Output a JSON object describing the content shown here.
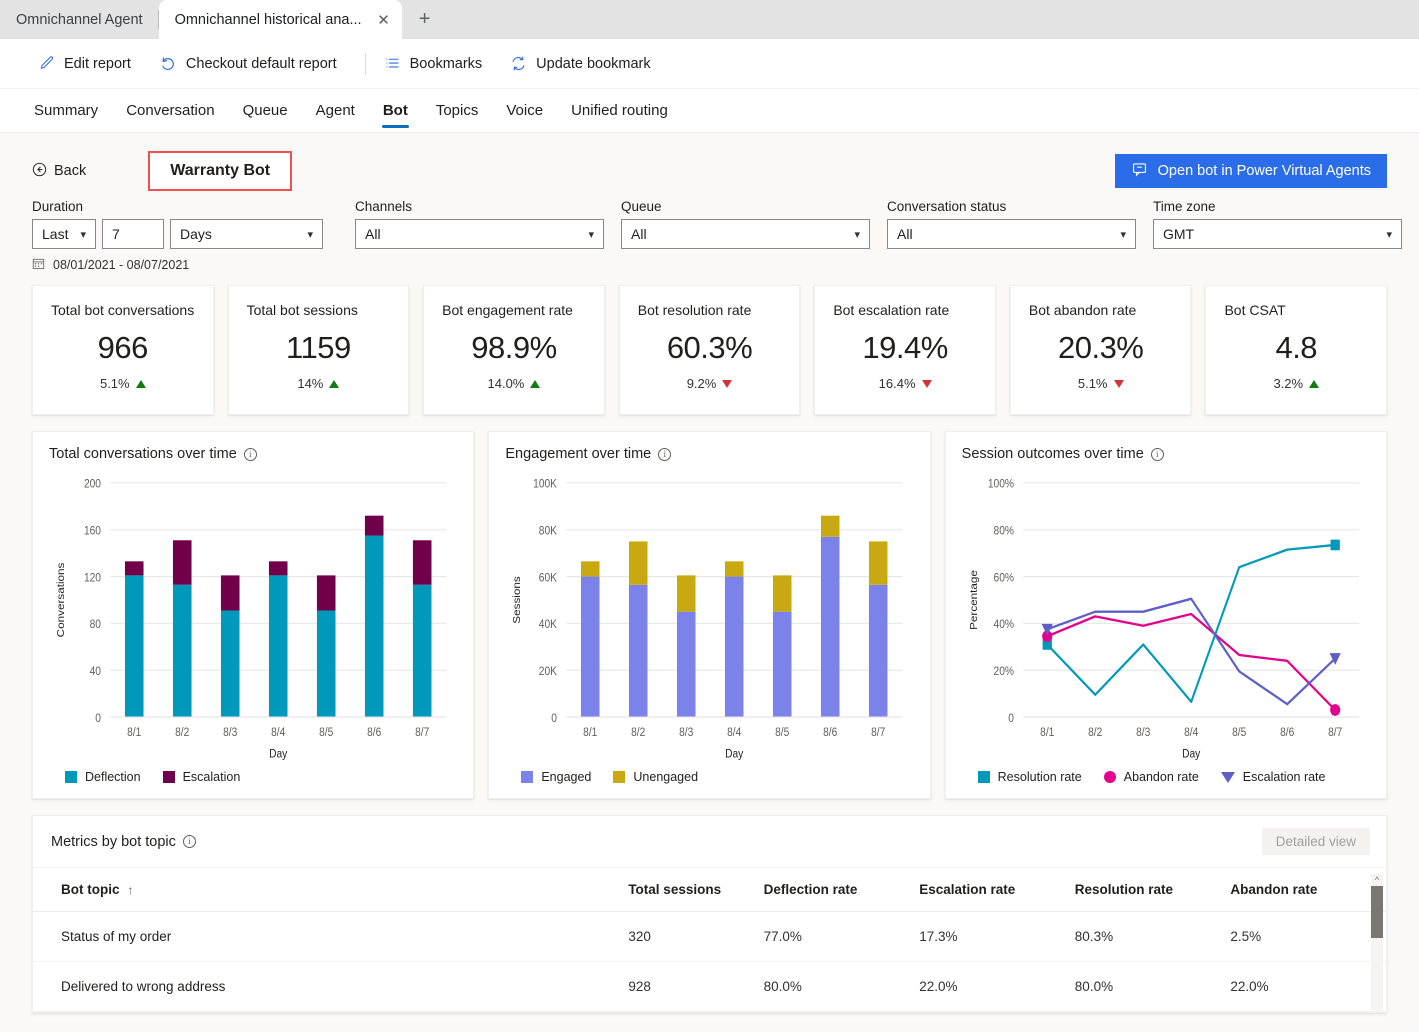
{
  "browser": {
    "tabs": [
      {
        "title": "Omnichannel Agent",
        "active": false
      },
      {
        "title": "Omnichannel historical ana...",
        "active": true
      }
    ],
    "close_icon": "close-icon",
    "new_tab_icon": "plus-icon"
  },
  "commandbar": {
    "items": [
      {
        "label": "Edit report",
        "icon": "pencil-icon"
      },
      {
        "label": "Checkout default report",
        "icon": "undo-icon"
      },
      {
        "label": "Bookmarks",
        "icon": "list-icon"
      },
      {
        "label": "Update bookmark",
        "icon": "refresh-icon"
      }
    ]
  },
  "nav": {
    "tabs": [
      {
        "label": "Summary",
        "selected": false
      },
      {
        "label": "Conversation",
        "selected": false
      },
      {
        "label": "Queue",
        "selected": false
      },
      {
        "label": "Agent",
        "selected": false
      },
      {
        "label": "Bot",
        "selected": true
      },
      {
        "label": "Topics",
        "selected": false
      },
      {
        "label": "Voice",
        "selected": false
      },
      {
        "label": "Unified routing",
        "selected": false
      }
    ]
  },
  "header": {
    "back_label": "Back",
    "back_icon": "back-circle-icon",
    "bot_name": "Warranty Bot",
    "highlight_color": "#f0514c",
    "pva_button_label": "Open bot in Power Virtual Agents",
    "pva_button_icon": "bot-chat-icon",
    "pva_button_color": "#2b6ce8"
  },
  "filters": {
    "duration": {
      "label": "Duration",
      "mode": "Last",
      "amount": "7",
      "unit": "Days"
    },
    "channels": {
      "label": "Channels",
      "value": "All"
    },
    "queue": {
      "label": "Queue",
      "value": "All"
    },
    "conversation_status": {
      "label": "Conversation status",
      "value": "All"
    },
    "time_zone": {
      "label": "Time zone",
      "value": "GMT"
    },
    "date_range": "08/01/2021 - 08/07/2021",
    "calendar_icon": "calendar-icon"
  },
  "kpis": [
    {
      "title": "Total bot conversations",
      "value": "966",
      "delta": "5.1%",
      "dir": "up"
    },
    {
      "title": "Total bot sessions",
      "value": "1159",
      "delta": "14%",
      "dir": "up"
    },
    {
      "title": "Bot engagement rate",
      "value": "98.9%",
      "delta": "14.0%",
      "dir": "up"
    },
    {
      "title": "Bot resolution rate",
      "value": "60.3%",
      "delta": "9.2%",
      "dir": "down"
    },
    {
      "title": "Bot escalation rate",
      "value": "19.4%",
      "delta": "16.4%",
      "dir": "down"
    },
    {
      "title": "Bot abandon rate",
      "value": "20.3%",
      "delta": "5.1%",
      "dir": "down"
    },
    {
      "title": "Bot CSAT",
      "value": "4.8",
      "delta": "3.2%",
      "dir": "up"
    }
  ],
  "chart_data": [
    {
      "type": "bar",
      "title": "Total conversations over time",
      "stacked": true,
      "xlabel": "Day",
      "ylabel": "Conversations",
      "categories": [
        "8/1",
        "8/2",
        "8/3",
        "8/4",
        "8/5",
        "8/6",
        "8/7"
      ],
      "ylim": [
        0,
        200
      ],
      "yticks": [
        0,
        40,
        80,
        120,
        160,
        200
      ],
      "ytick_labels": [
        "0",
        "40",
        "80",
        "120",
        "160",
        "200"
      ],
      "grid": true,
      "legend_position": "bottom",
      "series": [
        {
          "name": "Deflection",
          "color": "#0099bc",
          "values": [
            121,
            113,
            91,
            121,
            91,
            155,
            113
          ]
        },
        {
          "name": "Escalation",
          "color": "#70004a",
          "values": [
            12,
            38,
            30,
            12,
            30,
            17,
            38
          ]
        }
      ]
    },
    {
      "type": "bar",
      "title": "Engagement over time",
      "stacked": true,
      "xlabel": "Day",
      "ylabel": "Sessions",
      "categories": [
        "8/1",
        "8/2",
        "8/3",
        "8/4",
        "8/5",
        "8/6",
        "8/7"
      ],
      "ylim": [
        0,
        100000
      ],
      "yticks": [
        0,
        20000,
        40000,
        60000,
        80000,
        100000
      ],
      "ytick_labels": [
        "0",
        "20K",
        "40K",
        "60K",
        "80K",
        "100K"
      ],
      "grid": true,
      "legend_position": "bottom",
      "series": [
        {
          "name": "Engaged",
          "color": "#7b83eb",
          "values": [
            60000,
            56500,
            45000,
            60000,
            45000,
            77000,
            56500
          ]
        },
        {
          "name": "Unengaged",
          "color": "#c9a911",
          "values": [
            6500,
            18500,
            15500,
            6500,
            15500,
            9000,
            18500
          ]
        }
      ]
    },
    {
      "type": "line",
      "title": "Session outcomes over time",
      "xlabel": "Day",
      "ylabel": "Percentage",
      "categories": [
        "8/1",
        "8/2",
        "8/3",
        "8/4",
        "8/5",
        "8/6",
        "8/7"
      ],
      "ylim": [
        0,
        100
      ],
      "yticks": [
        0,
        20,
        40,
        60,
        80,
        100
      ],
      "ytick_labels": [
        "0",
        "20%",
        "40%",
        "60%",
        "80%",
        "100%"
      ],
      "grid": true,
      "legend_position": "bottom",
      "series": [
        {
          "name": "Resolution rate",
          "color": "#0099bc",
          "marker": "square",
          "values": [
            31,
            9.5,
            31,
            6.5,
            64,
            71.5,
            73.5
          ]
        },
        {
          "name": "Abandon rate",
          "color": "#e3008c",
          "marker": "circle",
          "values": [
            34.5,
            43,
            39,
            44,
            26.5,
            24,
            3
          ]
        },
        {
          "name": "Escalation rate",
          "color": "#5b5fc7",
          "marker": "triangle",
          "values": [
            37.5,
            45,
            45,
            50.5,
            19.5,
            5.5,
            25
          ]
        }
      ]
    }
  ],
  "table": {
    "title": "Metrics by bot topic",
    "detailed_view_label": "Detailed view",
    "sort_column": "Bot topic",
    "sort_direction": "asc",
    "columns": [
      "Bot topic",
      "Total sessions",
      "Deflection rate",
      "Escalation rate",
      "Resolution rate",
      "Abandon rate"
    ],
    "rows": [
      {
        "topic": "Status of my order",
        "total_sessions": "320",
        "deflection_rate": "77.0%",
        "escalation_rate": "17.3%",
        "resolution_rate": "80.3%",
        "abandon_rate": "2.5%"
      },
      {
        "topic": "Delivered to wrong address",
        "total_sessions": "928",
        "deflection_rate": "80.0%",
        "escalation_rate": "22.0%",
        "resolution_rate": "80.0%",
        "abandon_rate": "22.0%"
      }
    ]
  }
}
